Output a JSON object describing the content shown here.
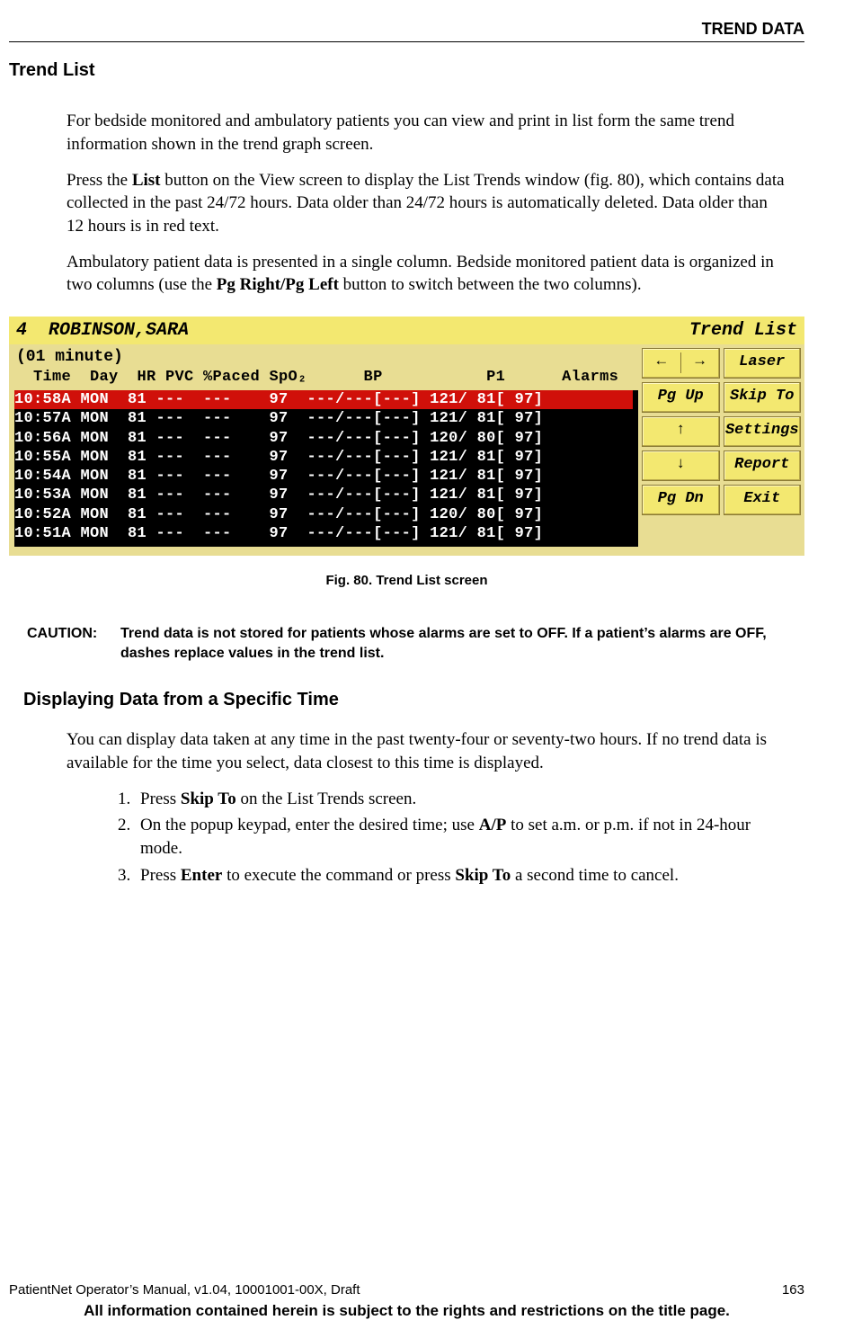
{
  "header": {
    "category": "TREND DATA"
  },
  "section": {
    "title": "Trend List"
  },
  "paragraphs": {
    "p1": "For bedside monitored and ambulatory patients you can view and print in list form the same trend information shown in the trend graph screen.",
    "p2a": "Press the ",
    "p2b": "List",
    "p2c": " button on the View screen to display the List Trends window (fig. 80), which contains data collected in the past 24/72 hours. Data older than 24/72 hours is automatically deleted. Data older than 12 hours is in red text.",
    "p3a": "Ambulatory patient data is presented in a single column. Bedside monitored patient data is organized in two columns (use the ",
    "p3b": "Pg Right/Pg Left",
    "p3c": " button to switch between the two columns)."
  },
  "figure": {
    "bed_label": "4",
    "patient_name": "ROBINSON,SARA",
    "screen_title": "Trend List",
    "interval": "(01 minute)",
    "col_line": "  Time  Day  HR PVC %Paced SpO₂      BP           P1      Alarms",
    "rows": [
      "10:58A MON  81 ---  ---    97  ---/---[---] 121/ 81[ 97]",
      "10:57A MON  81 ---  ---    97  ---/---[---] 121/ 81[ 97]",
      "10:56A MON  81 ---  ---    97  ---/---[---] 120/ 80[ 97]",
      "10:55A MON  81 ---  ---    97  ---/---[---] 121/ 81[ 97]",
      "10:54A MON  81 ---  ---    97  ---/---[---] 121/ 81[ 97]",
      "10:53A MON  81 ---  ---    97  ---/---[---] 121/ 81[ 97]",
      "10:52A MON  81 ---  ---    97  ---/---[---] 120/ 80[ 97]",
      "10:51A MON  81 ---  ---    97  ---/---[---] 121/ 81[ 97]"
    ],
    "buttons": {
      "arrow_left": "←",
      "arrow_right": "→",
      "laser": "Laser",
      "pg_up": "Pg Up",
      "skip_to": "Skip To",
      "arrow_up": "↑",
      "settings": "Settings",
      "arrow_down": "↓",
      "report": "Report",
      "pg_dn": "Pg Dn",
      "exit": "Exit"
    },
    "caption": "Fig. 80. Trend List screen"
  },
  "caution": {
    "label": "CAUTION:",
    "text": "Trend data is not stored for patients whose alarms are set to OFF. If a patient’s alarms are OFF, dashes replace values in the trend list."
  },
  "subsection": {
    "title": "Displaying Data from a Specific Time"
  },
  "sub_p": "You can display data taken at any time in the past twenty-four or seventy-two hours. If no trend data is available for the time you select, data closest to this time is displayed.",
  "steps": {
    "s1a": "Press ",
    "s1b": "Skip To",
    "s1c": " on the List Trends screen.",
    "s2a": "On the popup keypad, enter the desired time; use ",
    "s2b": "A/P",
    "s2c": " to set a.m. or p.m. if not in 24-hour mode.",
    "s3a": "Press ",
    "s3b": "Enter",
    "s3c": " to execute the command or press ",
    "s3d": "Skip To",
    "s3e": " a second time to cancel."
  },
  "footer": {
    "left": "PatientNet Operator’s Manual, v1.04, 10001001-00X, Draft",
    "right": "163",
    "bottom": "All information contained herein is subject to the rights and restrictions on the title page."
  }
}
